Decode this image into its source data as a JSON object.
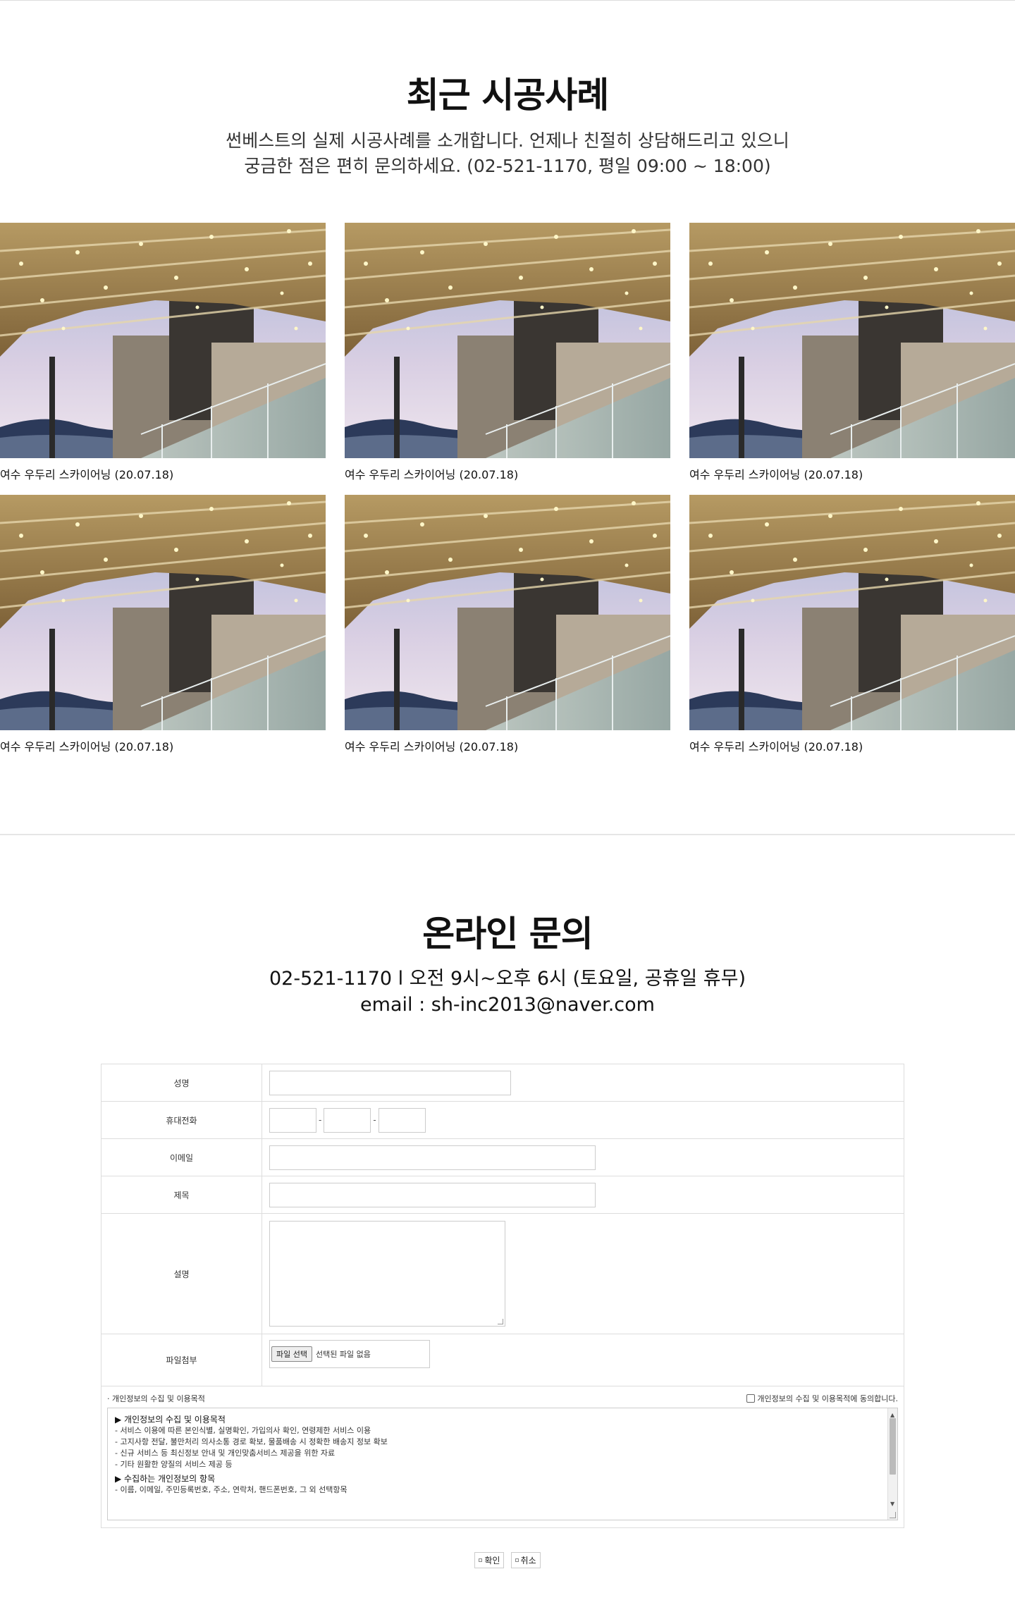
{
  "recent": {
    "title": "최근 시공사례",
    "desc_line1": "썬베스트의 실제 시공사례를 소개합니다. 언제나 친절히 상담해드리고 있으니",
    "desc_line2": "궁금한 점은 편히 문의하세요. (02-521-1170, 평일 09:00 ~ 18:00)",
    "items": [
      {
        "caption": "여수 우두리 스카이어닝 (20.07.18)"
      },
      {
        "caption": "여수 우두리 스카이어닝 (20.07.18)"
      },
      {
        "caption": "여수 우두리 스카이어닝 (20.07.18)"
      },
      {
        "caption": "여수 우두리 스카이어닝 (20.07.18)"
      },
      {
        "caption": "여수 우두리 스카이어닝 (20.07.18)"
      },
      {
        "caption": "여수 우두리 스카이어닝 (20.07.18)"
      }
    ]
  },
  "inquiry": {
    "title": "온라인 문의",
    "info_line1": "02-521-1170 l 오전 9시~오후 6시 (토요일, 공휴일 휴무)",
    "info_line2": "email : sh-inc2013@naver.com"
  },
  "form": {
    "name_label": "성명",
    "phone_label": "휴대전화",
    "phone_dash": "-",
    "email_label": "이메일",
    "subject_label": "제목",
    "desc_label": "설명",
    "file_label": "파일첨부",
    "file_button": "파일 선택",
    "file_status": "선택된 파일 없음",
    "privacy_title": "· 개인정보의 수집 및 이용목적",
    "privacy_agree": "개인정보의 수집 및 이용목적에 동의합니다.",
    "privacy_text": {
      "h1": "▶ 개인정보의 수집 및 이용목적",
      "l1": "- 서비스 이용에 따른 본인식별, 실명확인, 가입의사 확인, 연령제한 서비스 이용",
      "l2": "- 고지사항 전달, 불만처리 의사소통 경로 확보, 물품배송 시 정확한 배송지 정보 확보",
      "l3": "- 신규 서비스 등 최신정보 안내 및 개인맞춤서비스 제공을 위한 자료",
      "l4": "- 기타 원활한 양질의 서비스 제공 등",
      "h2": "▶ 수집하는 개인정보의 항목",
      "l5": "- 이름, 이메일, 주민등록번호, 주소, 연락처, 핸드폰번호, 그 외 선택항목"
    },
    "confirm": "확인",
    "cancel": "취소"
  }
}
